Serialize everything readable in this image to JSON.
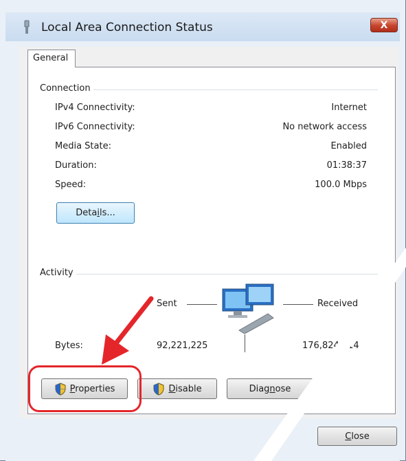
{
  "window": {
    "title": "Local Area Connection Status",
    "close_glyph": "X"
  },
  "tabs": [
    {
      "label": "General",
      "active": true
    }
  ],
  "connection": {
    "group_label": "Connection",
    "rows": [
      {
        "label": "IPv4 Connectivity:",
        "value": "Internet"
      },
      {
        "label": "IPv6 Connectivity:",
        "value": "No network access"
      },
      {
        "label": "Media State:",
        "value": "Enabled"
      },
      {
        "label": "Duration:",
        "value": "01:38:37"
      },
      {
        "label": "Speed:",
        "value": "100.0 Mbps"
      }
    ],
    "details_button": {
      "mnemonic": "",
      "label_pre": "Deta",
      "label_ul": "i",
      "label_post": "ls..."
    }
  },
  "activity": {
    "group_label": "Activity",
    "sent_label": "Sent",
    "received_label": "Received",
    "bytes_label": "Bytes:",
    "bytes_sent": "92,221,225",
    "bytes_received": "176,824,414",
    "network_icon": "network-computer-icon"
  },
  "buttons": {
    "properties": {
      "ul": "P",
      "rest": "roperties",
      "icon": "uac-shield-icon"
    },
    "disable": {
      "ul": "D",
      "rest": "isable",
      "icon": "uac-shield-icon"
    },
    "diagnose": {
      "pre": "Diag",
      "ul": "n",
      "post": "ose"
    },
    "close": {
      "ul": "C",
      "rest": "lose"
    }
  },
  "colors": {
    "annotation_red": "#e4262b",
    "close_button_red": "#c7422b",
    "focus_blue": "#3c7fb1"
  }
}
